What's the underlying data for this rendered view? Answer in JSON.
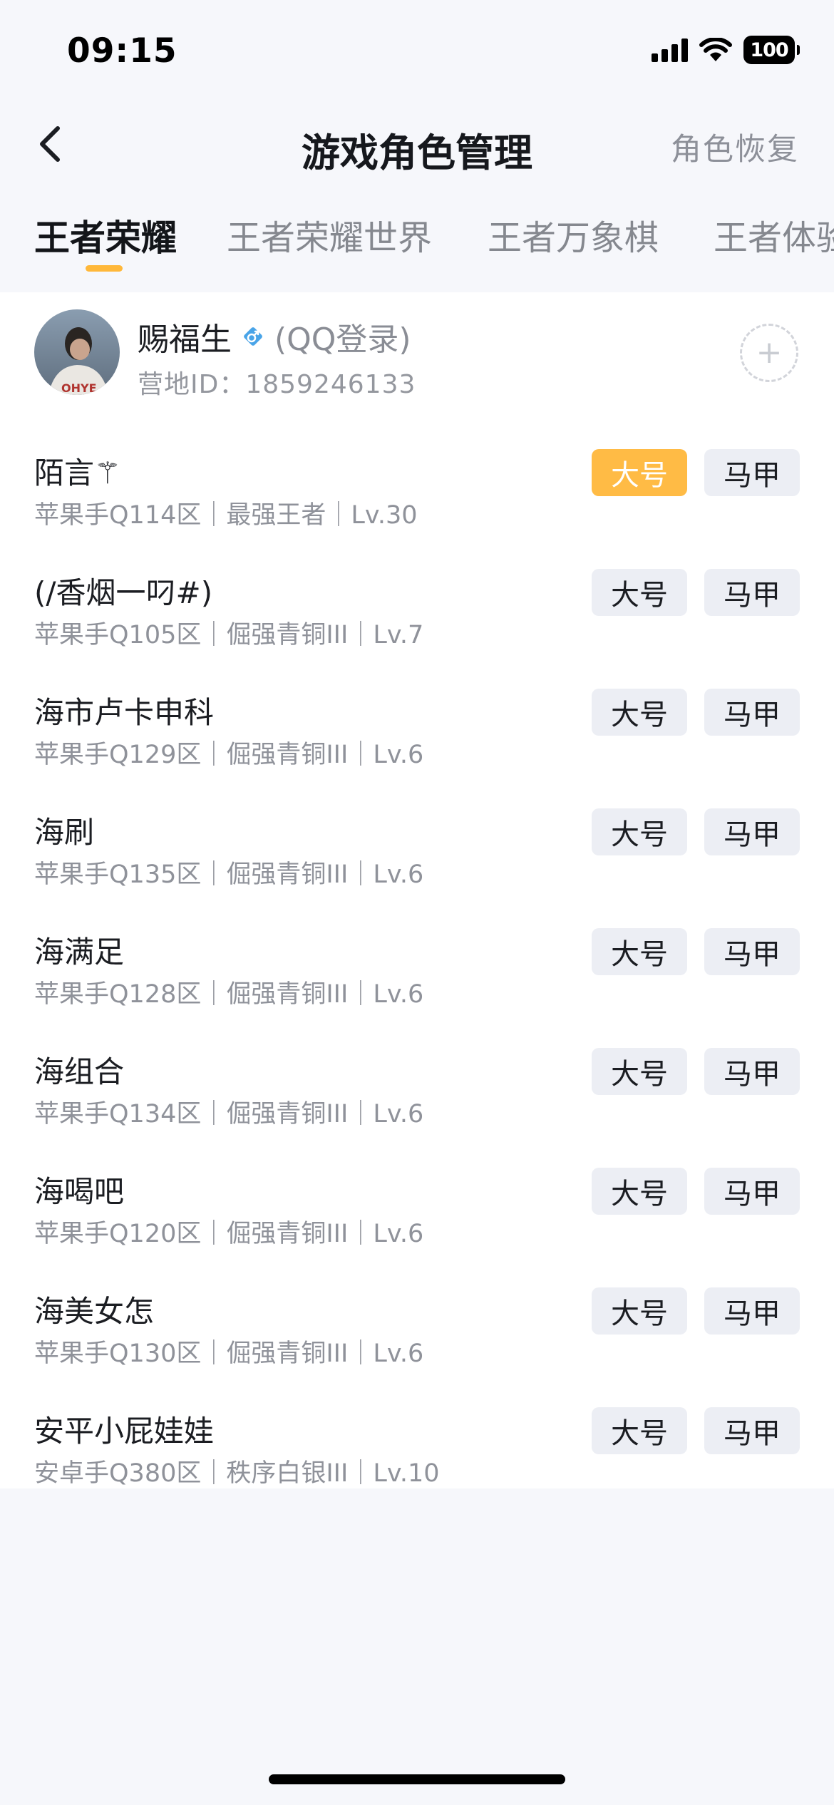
{
  "status_bar": {
    "time": "09:15",
    "battery": "100",
    "icons": [
      "cellular-signal-icon",
      "wifi-icon",
      "battery-icon"
    ]
  },
  "header": {
    "title": "游戏角色管理",
    "restore_label": "角色恢复",
    "back_icon": "chevron-left-icon"
  },
  "tabs": [
    {
      "label": "王者荣耀",
      "active": true
    },
    {
      "label": "王者荣耀世界",
      "active": false
    },
    {
      "label": "王者万象棋",
      "active": false
    },
    {
      "label": "王者体验",
      "active": false
    }
  ],
  "account": {
    "name": "赐福生",
    "gender_icon": "male-icon",
    "login_type": "(QQ登录)",
    "camp_id": "营地ID：1859246133",
    "add_icon": "plus-icon"
  },
  "role_tags": {
    "main": "大号",
    "alt": "马甲"
  },
  "roles": [
    {
      "name": "陌言⚚",
      "info": "苹果手Q114区｜最强王者｜Lv.30",
      "main_selected": true
    },
    {
      "name": "(/香烟一叼#)",
      "info": "苹果手Q105区｜倔强青铜III｜Lv.7",
      "main_selected": false
    },
    {
      "name": "海市卢卡申科",
      "info": "苹果手Q129区｜倔强青铜III｜Lv.6",
      "main_selected": false
    },
    {
      "name": "海刷",
      "info": "苹果手Q135区｜倔强青铜III｜Lv.6",
      "main_selected": false
    },
    {
      "name": "海满足",
      "info": "苹果手Q128区｜倔强青铜III｜Lv.6",
      "main_selected": false
    },
    {
      "name": "海组合",
      "info": "苹果手Q134区｜倔强青铜III｜Lv.6",
      "main_selected": false
    },
    {
      "name": "海喝吧",
      "info": "苹果手Q120区｜倔强青铜III｜Lv.6",
      "main_selected": false
    },
    {
      "name": "海美女怎",
      "info": "苹果手Q130区｜倔强青铜III｜Lv.6",
      "main_selected": false
    },
    {
      "name": "安平小屁娃娃",
      "info": "安卓手Q380区｜秩序白银III｜Lv.10",
      "main_selected": false
    }
  ],
  "colors": {
    "accent": "#ffbb45",
    "background": "#f6f7fb",
    "tag_background": "#eceef4"
  }
}
